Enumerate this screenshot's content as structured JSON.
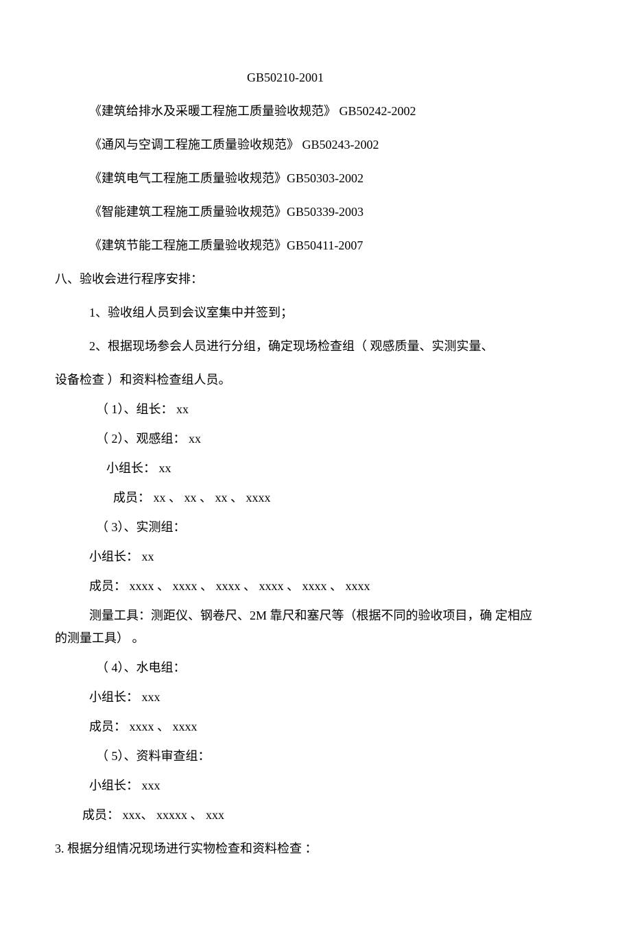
{
  "header": {
    "code": "GB50210-2001"
  },
  "standards": [
    "《建筑给排水及采暖工程施工质量验收规范》  GB50242-2002",
    "《通风与空调工程施工质量验收规范》  GB50243-2002",
    "《建筑电气工程施工质量验收规范》GB50303-2002",
    "《智能建筑工程施工质量验收规范》GB50339-2003",
    "《建筑节能工程施工质量验收规范》GB50411-2007"
  ],
  "section8": {
    "title": "八、验收会进行程序安排：",
    "item1": "1、验收组人员到会议室集中并签到；",
    "item2_a": "2、根据现场参会人员进行分组，确定现场检查组（ 观感质量、实测实量、",
    "item2_b": "设备检查  ）和资料检查组人员。",
    "group1": "（ 1）、组长：  xx",
    "group2": "（ 2）、观感组：  xx",
    "group2_leader": "小组长：  xx",
    "group2_members": "成员：  xx 、  xx 、  xx 、  xxxx",
    "group3": "（ 3）、实测组：",
    "group3_leader": "小组长：  xx",
    "group3_members": "成员：  xxxx 、  xxxx 、  xxxx 、  xxxx 、  xxxx 、  xxxx",
    "group3_tools_a": "测量工具：测距仪、钢卷尺、2M 靠尺和塞尺等（根据不同的验收项目，确  定相应",
    "group3_tools_b": "的测量工具）  。",
    "group4": "（ 4）、水电组：",
    "group4_leader": "小组长：  xxx",
    "group4_members": "成员：  xxxx 、  xxxx",
    "group5": "（ 5）、资料审查组：",
    "group5_leader": "小组长：  xxx",
    "group5_members": "成员：  xxx、  xxxxx 、  xxx",
    "item3": "3. 根据分组情况现场进行实物检查和资料检查  ："
  }
}
